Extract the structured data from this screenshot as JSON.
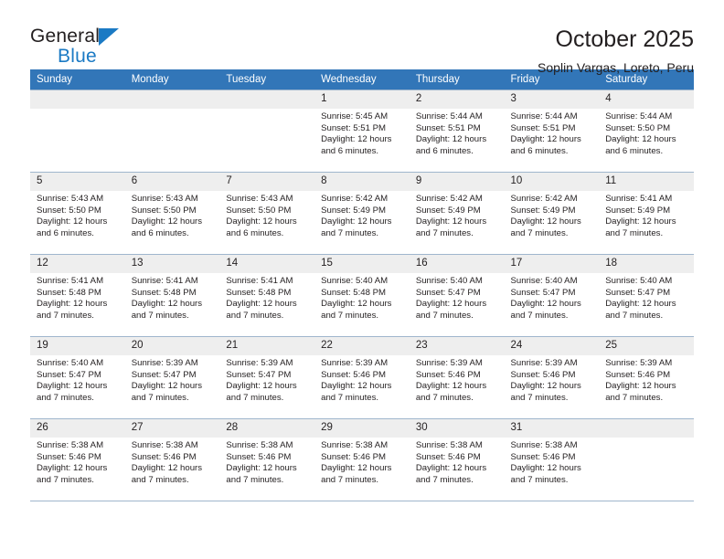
{
  "brand": {
    "name_top": "General",
    "name_bottom": "Blue",
    "triangle_icon": "brand-triangle-icon",
    "accent_color": "#1b7ac4"
  },
  "header": {
    "title": "October 2025",
    "subtitle": "Soplin Vargas, Loreto, Peru"
  },
  "theme": {
    "header_blue": "#3276b8",
    "daynum_gray": "#eeeeee",
    "grid_line": "#9fb6cd",
    "text": "#231f20"
  },
  "weekday_headers": [
    "Sunday",
    "Monday",
    "Tuesday",
    "Wednesday",
    "Thursday",
    "Friday",
    "Saturday"
  ],
  "weeks": [
    [
      {
        "day": "",
        "sunrise": "",
        "sunset": "",
        "daylight": ""
      },
      {
        "day": "",
        "sunrise": "",
        "sunset": "",
        "daylight": ""
      },
      {
        "day": "",
        "sunrise": "",
        "sunset": "",
        "daylight": ""
      },
      {
        "day": "1",
        "sunrise": "Sunrise: 5:45 AM",
        "sunset": "Sunset: 5:51 PM",
        "daylight": "Daylight: 12 hours and 6 minutes."
      },
      {
        "day": "2",
        "sunrise": "Sunrise: 5:44 AM",
        "sunset": "Sunset: 5:51 PM",
        "daylight": "Daylight: 12 hours and 6 minutes."
      },
      {
        "day": "3",
        "sunrise": "Sunrise: 5:44 AM",
        "sunset": "Sunset: 5:51 PM",
        "daylight": "Daylight: 12 hours and 6 minutes."
      },
      {
        "day": "4",
        "sunrise": "Sunrise: 5:44 AM",
        "sunset": "Sunset: 5:50 PM",
        "daylight": "Daylight: 12 hours and 6 minutes."
      }
    ],
    [
      {
        "day": "5",
        "sunrise": "Sunrise: 5:43 AM",
        "sunset": "Sunset: 5:50 PM",
        "daylight": "Daylight: 12 hours and 6 minutes."
      },
      {
        "day": "6",
        "sunrise": "Sunrise: 5:43 AM",
        "sunset": "Sunset: 5:50 PM",
        "daylight": "Daylight: 12 hours and 6 minutes."
      },
      {
        "day": "7",
        "sunrise": "Sunrise: 5:43 AM",
        "sunset": "Sunset: 5:50 PM",
        "daylight": "Daylight: 12 hours and 6 minutes."
      },
      {
        "day": "8",
        "sunrise": "Sunrise: 5:42 AM",
        "sunset": "Sunset: 5:49 PM",
        "daylight": "Daylight: 12 hours and 7 minutes."
      },
      {
        "day": "9",
        "sunrise": "Sunrise: 5:42 AM",
        "sunset": "Sunset: 5:49 PM",
        "daylight": "Daylight: 12 hours and 7 minutes."
      },
      {
        "day": "10",
        "sunrise": "Sunrise: 5:42 AM",
        "sunset": "Sunset: 5:49 PM",
        "daylight": "Daylight: 12 hours and 7 minutes."
      },
      {
        "day": "11",
        "sunrise": "Sunrise: 5:41 AM",
        "sunset": "Sunset: 5:49 PM",
        "daylight": "Daylight: 12 hours and 7 minutes."
      }
    ],
    [
      {
        "day": "12",
        "sunrise": "Sunrise: 5:41 AM",
        "sunset": "Sunset: 5:48 PM",
        "daylight": "Daylight: 12 hours and 7 minutes."
      },
      {
        "day": "13",
        "sunrise": "Sunrise: 5:41 AM",
        "sunset": "Sunset: 5:48 PM",
        "daylight": "Daylight: 12 hours and 7 minutes."
      },
      {
        "day": "14",
        "sunrise": "Sunrise: 5:41 AM",
        "sunset": "Sunset: 5:48 PM",
        "daylight": "Daylight: 12 hours and 7 minutes."
      },
      {
        "day": "15",
        "sunrise": "Sunrise: 5:40 AM",
        "sunset": "Sunset: 5:48 PM",
        "daylight": "Daylight: 12 hours and 7 minutes."
      },
      {
        "day": "16",
        "sunrise": "Sunrise: 5:40 AM",
        "sunset": "Sunset: 5:47 PM",
        "daylight": "Daylight: 12 hours and 7 minutes."
      },
      {
        "day": "17",
        "sunrise": "Sunrise: 5:40 AM",
        "sunset": "Sunset: 5:47 PM",
        "daylight": "Daylight: 12 hours and 7 minutes."
      },
      {
        "day": "18",
        "sunrise": "Sunrise: 5:40 AM",
        "sunset": "Sunset: 5:47 PM",
        "daylight": "Daylight: 12 hours and 7 minutes."
      }
    ],
    [
      {
        "day": "19",
        "sunrise": "Sunrise: 5:40 AM",
        "sunset": "Sunset: 5:47 PM",
        "daylight": "Daylight: 12 hours and 7 minutes."
      },
      {
        "day": "20",
        "sunrise": "Sunrise: 5:39 AM",
        "sunset": "Sunset: 5:47 PM",
        "daylight": "Daylight: 12 hours and 7 minutes."
      },
      {
        "day": "21",
        "sunrise": "Sunrise: 5:39 AM",
        "sunset": "Sunset: 5:47 PM",
        "daylight": "Daylight: 12 hours and 7 minutes."
      },
      {
        "day": "22",
        "sunrise": "Sunrise: 5:39 AM",
        "sunset": "Sunset: 5:46 PM",
        "daylight": "Daylight: 12 hours and 7 minutes."
      },
      {
        "day": "23",
        "sunrise": "Sunrise: 5:39 AM",
        "sunset": "Sunset: 5:46 PM",
        "daylight": "Daylight: 12 hours and 7 minutes."
      },
      {
        "day": "24",
        "sunrise": "Sunrise: 5:39 AM",
        "sunset": "Sunset: 5:46 PM",
        "daylight": "Daylight: 12 hours and 7 minutes."
      },
      {
        "day": "25",
        "sunrise": "Sunrise: 5:39 AM",
        "sunset": "Sunset: 5:46 PM",
        "daylight": "Daylight: 12 hours and 7 minutes."
      }
    ],
    [
      {
        "day": "26",
        "sunrise": "Sunrise: 5:38 AM",
        "sunset": "Sunset: 5:46 PM",
        "daylight": "Daylight: 12 hours and 7 minutes."
      },
      {
        "day": "27",
        "sunrise": "Sunrise: 5:38 AM",
        "sunset": "Sunset: 5:46 PM",
        "daylight": "Daylight: 12 hours and 7 minutes."
      },
      {
        "day": "28",
        "sunrise": "Sunrise: 5:38 AM",
        "sunset": "Sunset: 5:46 PM",
        "daylight": "Daylight: 12 hours and 7 minutes."
      },
      {
        "day": "29",
        "sunrise": "Sunrise: 5:38 AM",
        "sunset": "Sunset: 5:46 PM",
        "daylight": "Daylight: 12 hours and 7 minutes."
      },
      {
        "day": "30",
        "sunrise": "Sunrise: 5:38 AM",
        "sunset": "Sunset: 5:46 PM",
        "daylight": "Daylight: 12 hours and 7 minutes."
      },
      {
        "day": "31",
        "sunrise": "Sunrise: 5:38 AM",
        "sunset": "Sunset: 5:46 PM",
        "daylight": "Daylight: 12 hours and 7 minutes."
      },
      {
        "day": "",
        "sunrise": "",
        "sunset": "",
        "daylight": ""
      }
    ]
  ]
}
